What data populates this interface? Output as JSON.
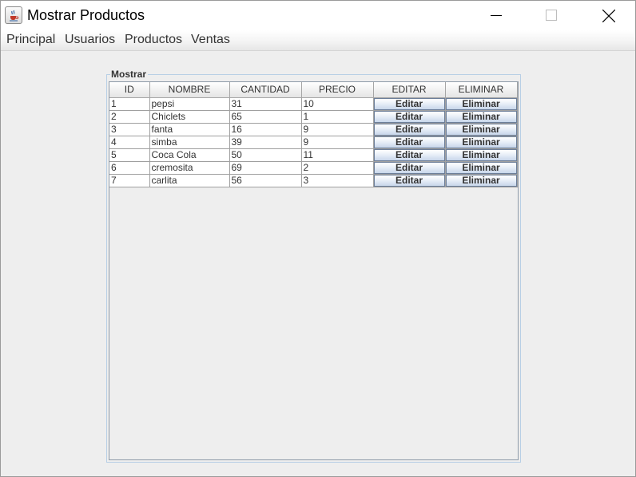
{
  "window": {
    "title": "Mostrar Productos",
    "icon": "java-coffee-icon",
    "controls": [
      "minimize-icon",
      "maximize-icon",
      "close-icon"
    ]
  },
  "menu": {
    "items": [
      "Principal",
      "Usuarios",
      "Productos",
      "Ventas"
    ]
  },
  "panel": {
    "legend": "Mostrar"
  },
  "table": {
    "columns": [
      "ID",
      "NOMBRE",
      "CANTIDAD",
      "PRECIO",
      "EDITAR",
      "ELIMINAR"
    ],
    "rows": [
      {
        "id": "1",
        "nombre": "pepsi",
        "cantidad": "31",
        "precio": "10",
        "editar": "Editar",
        "eliminar": "Eliminar"
      },
      {
        "id": "2",
        "nombre": "Chiclets",
        "cantidad": "65",
        "precio": "1",
        "editar": "Editar",
        "eliminar": "Eliminar"
      },
      {
        "id": "3",
        "nombre": "fanta",
        "cantidad": "16",
        "precio": "9",
        "editar": "Editar",
        "eliminar": "Eliminar"
      },
      {
        "id": "4",
        "nombre": "simba",
        "cantidad": "39",
        "precio": "9",
        "editar": "Editar",
        "eliminar": "Eliminar"
      },
      {
        "id": "5",
        "nombre": "Coca Cola",
        "cantidad": "50",
        "precio": "11",
        "editar": "Editar",
        "eliminar": "Eliminar"
      },
      {
        "id": "6",
        "nombre": "cremosita",
        "cantidad": "69",
        "precio": "2",
        "editar": "Editar",
        "eliminar": "Eliminar"
      },
      {
        "id": "7",
        "nombre": "carlita",
        "cantidad": "56",
        "precio": "3",
        "editar": "Editar",
        "eliminar": "Eliminar"
      }
    ]
  },
  "colors": {
    "window_background": "#eeeeee",
    "titlebar": "#ffffff",
    "panel_border": "#b8cfe5",
    "button_border": "#6d7f9a",
    "button_gradient_bottom": "#c8d6ea"
  }
}
